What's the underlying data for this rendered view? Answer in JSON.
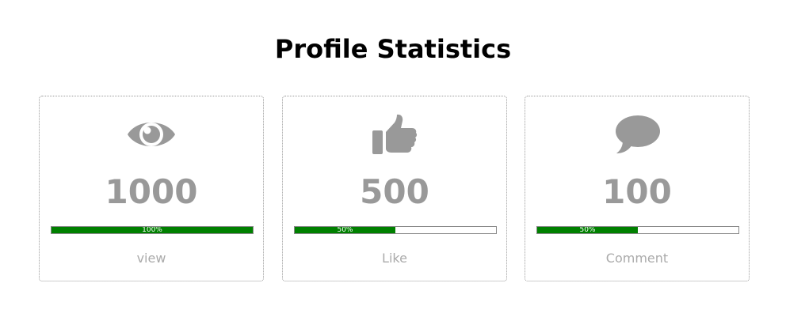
{
  "page": {
    "title": "Profile Statistics"
  },
  "stats": [
    {
      "icon": "eye-icon",
      "count": "1000",
      "progress_label": "100%",
      "progress_fraction": 1.0,
      "label": "view"
    },
    {
      "icon": "thumbs-up-icon",
      "count": "500",
      "progress_label": "50%",
      "progress_fraction": 0.5,
      "label": "Like"
    },
    {
      "icon": "comment-icon",
      "count": "100",
      "progress_label": "50%",
      "progress_fraction": 0.5,
      "label": "Comment"
    }
  ],
  "colors": {
    "icon": "#999999",
    "count": "#999999",
    "label": "#aaaaaa",
    "progress_fill": "#008000",
    "card_border": "#9a9a9a"
  }
}
